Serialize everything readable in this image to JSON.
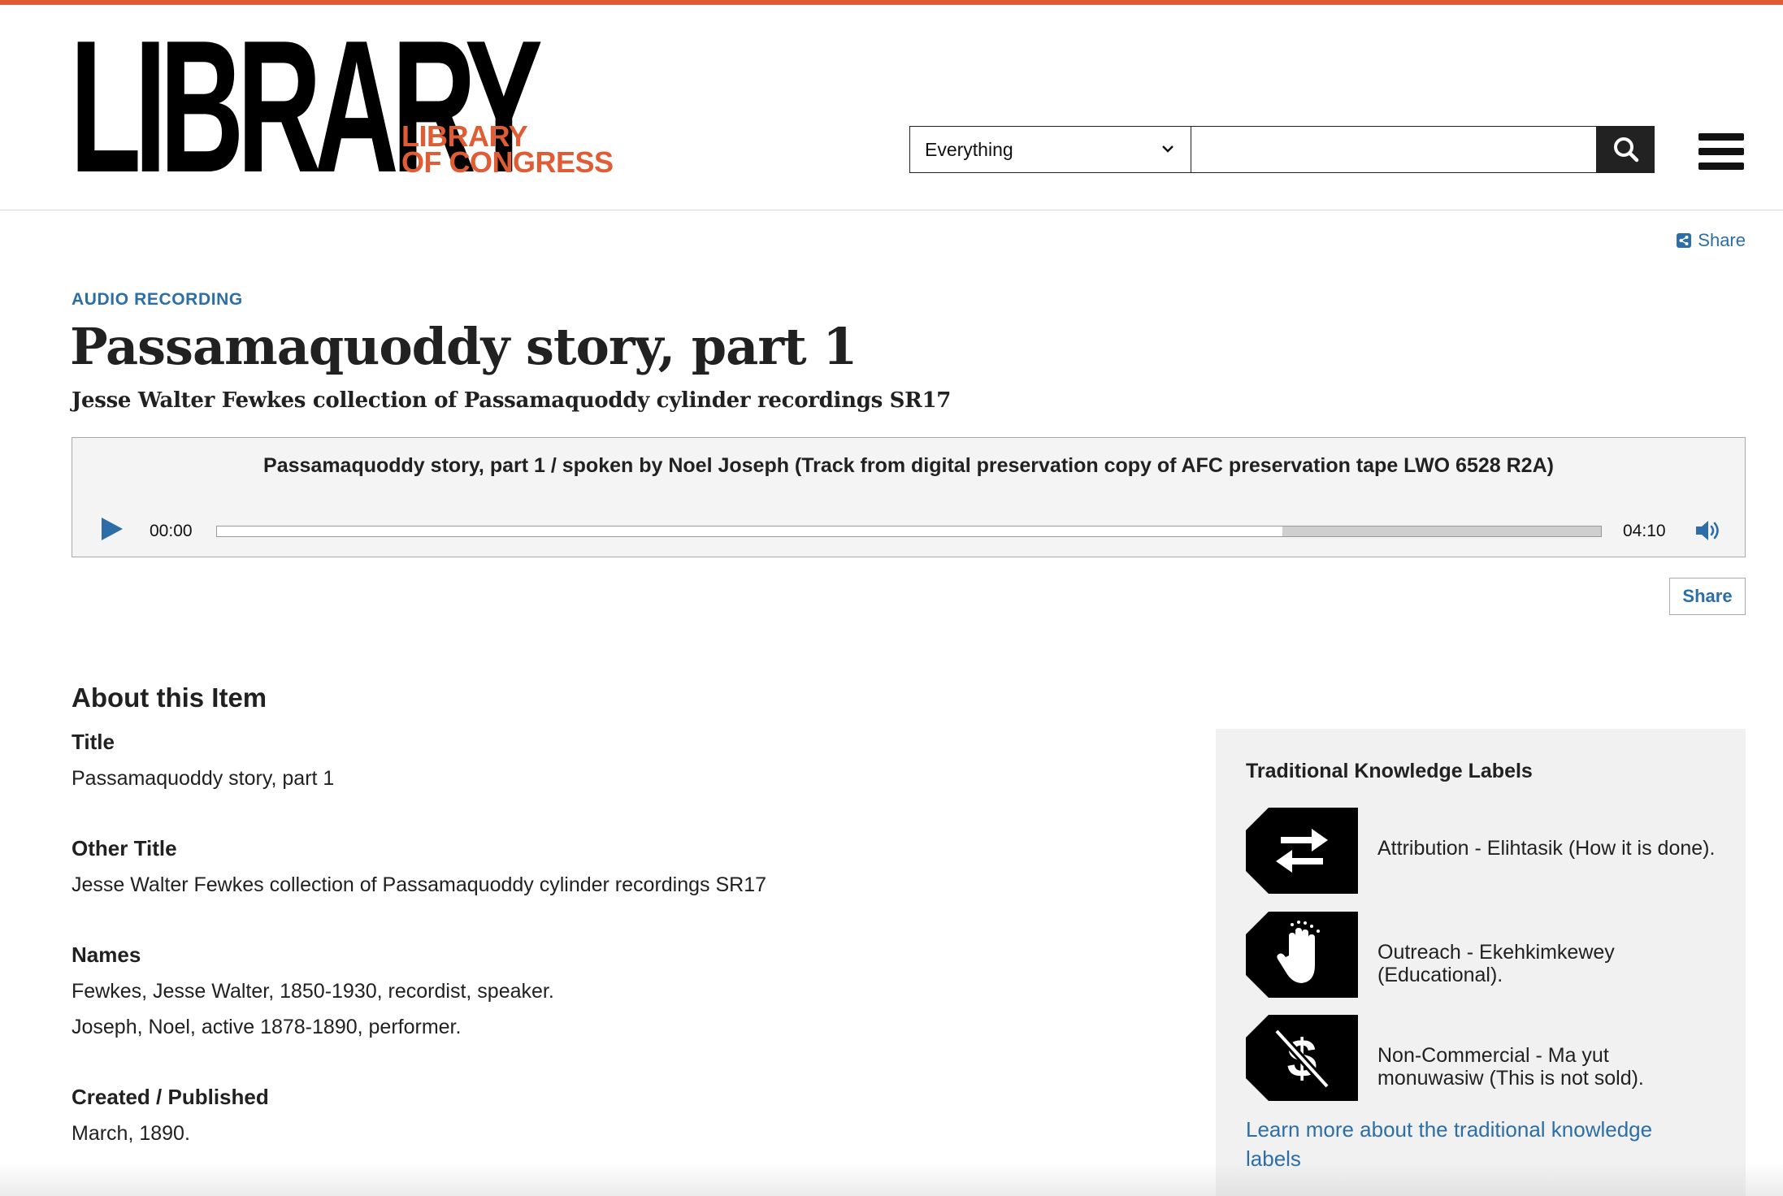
{
  "header": {
    "logo_wordmark": "LIBRARY",
    "logo_line1": "LIBRARY",
    "logo_line2": "OF CONGRESS",
    "search_scope": "Everything",
    "search_placeholder": "",
    "icons": {
      "search": "search-icon",
      "menu": "hamburger-menu-icon",
      "dropdown": "chevron-down-icon"
    }
  },
  "share_top": {
    "label": "Share",
    "icon": "share-icon"
  },
  "item": {
    "format": "AUDIO RECORDING",
    "title": "Passamaquoddy story, part 1",
    "subtitle": "Jesse Walter Fewkes collection of Passamaquoddy cylinder recordings SR17"
  },
  "player": {
    "caption": "Passamaquoddy story, part 1 / spoken by Noel Joseph (Track from digital preservation copy of AFC preservation tape LWO 6528 R2A)",
    "current_time": "00:00",
    "duration": "04:10",
    "played_fraction": 0,
    "buffered_fraction": 0.77,
    "icons": {
      "play": "play-icon",
      "volume": "volume-icon"
    }
  },
  "share_button": {
    "label": "Share"
  },
  "about": {
    "heading": "About this Item",
    "fields": [
      {
        "label": "Title",
        "values": [
          "Passamaquoddy story, part 1"
        ]
      },
      {
        "label": "Other Title",
        "values": [
          "Jesse Walter Fewkes collection of Passamaquoddy cylinder recordings SR17"
        ]
      },
      {
        "label": "Names",
        "values": [
          "Fewkes, Jesse Walter, 1850-1930, recordist, speaker.",
          "Joseph, Noel, active 1878-1890, performer."
        ]
      },
      {
        "label": "Created / Published",
        "values": [
          "March, 1890."
        ]
      }
    ]
  },
  "tk_labels": {
    "heading": "Traditional Knowledge Labels",
    "items": [
      {
        "icon": "attribution-arrows-icon",
        "text": "Attribution - Elihtasik (How it is done)."
      },
      {
        "icon": "outreach-hand-icon",
        "text": "Outreach - Ekehkimkewey (Educational)."
      },
      {
        "icon": "non-commercial-dollar-icon",
        "text": "Non-Commercial - Ma yut monuwasiw (This is not sold)."
      }
    ],
    "link": "Learn more about the traditional knowledge labels"
  },
  "colors": {
    "accent": "#e05c34",
    "link": "#2c6ea5",
    "text": "#212121"
  }
}
